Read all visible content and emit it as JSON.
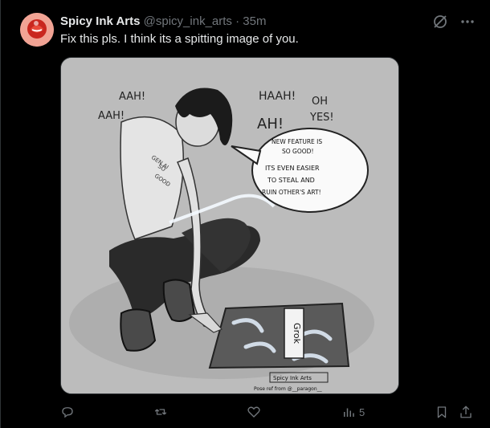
{
  "post": {
    "author_name": "Spicy Ink Arts",
    "author_handle": "@spicy_ink_arts",
    "separator": "·",
    "time": "35m",
    "text": "Fix this pls. I think its a spitting image of you."
  },
  "media": {
    "sounds": [
      "AAH!",
      "AAH!",
      "HAAH!",
      "AH!",
      "OH",
      "YES!"
    ],
    "tattoo": [
      "GEN AI",
      "SO",
      "GOOD"
    ],
    "speech_bubble": [
      "NEW FEATURE IS",
      "SO GOOD!",
      "ITS EVEN EASIER",
      "TO STEAL AND",
      "RUIN OTHER'S ART!"
    ],
    "canvas_text": "Grok",
    "signature": [
      "Spicy Ink Arts",
      "Pose ref from @__paragon__"
    ]
  },
  "actions": {
    "views_count": "5"
  },
  "colors": {
    "background": "#000000",
    "text_primary": "#e7e9ea",
    "text_secondary": "#71767b"
  }
}
